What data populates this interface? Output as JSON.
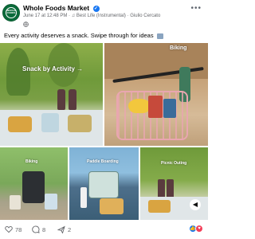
{
  "post": {
    "page_name": "Whole Foods Market",
    "verified_glyph": "✓",
    "date": "June 17 at 12:48 PM",
    "separator": "·",
    "music_note": "♫",
    "song": "Best Life (Instrumental)",
    "separator2": "·",
    "artist": "Giulio Cercato",
    "avatar_text": "WHOLE FOODS",
    "more_glyph": "•••",
    "caption": "Every activity deserves a snack. Swipe through for ideas"
  },
  "tiles": [
    {
      "label": "Snack by Activity →"
    },
    {
      "label": "Biking"
    },
    {
      "label": "Biking"
    },
    {
      "label": "Paddle Boarding"
    },
    {
      "label": "Picnic Outing"
    }
  ],
  "footer": {
    "likes": "78",
    "comments": "8",
    "shares": "2"
  },
  "colors": {
    "brand_green": "#0a6b3a",
    "fb_blue": "#1877f2",
    "muted_text": "#65676b"
  }
}
